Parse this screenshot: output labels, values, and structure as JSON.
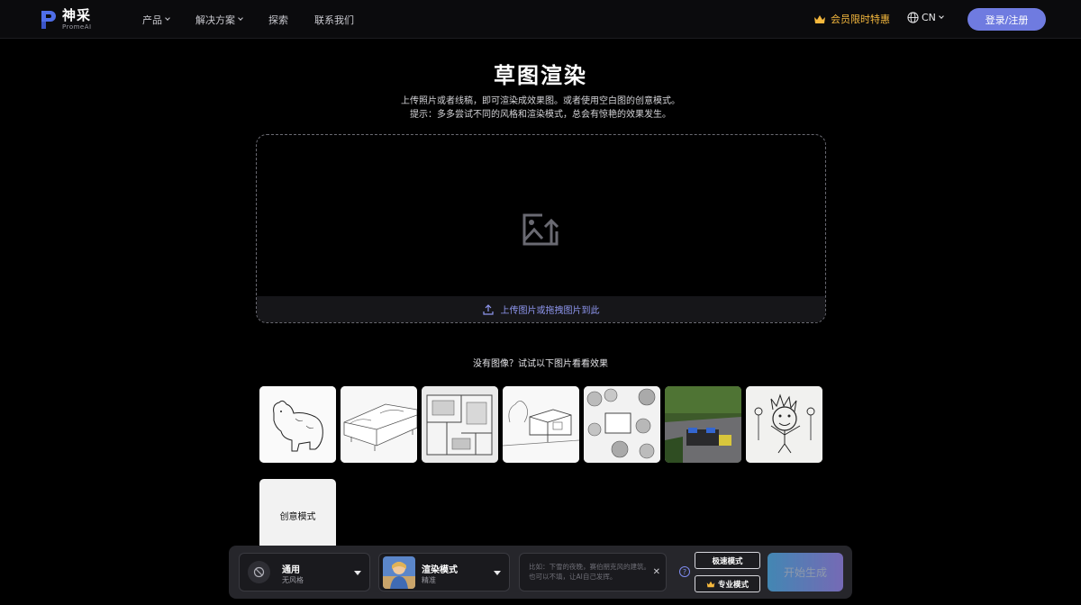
{
  "header": {
    "logo": {
      "cn": "神采",
      "en": "PromeAI"
    },
    "nav": [
      {
        "label": "产品",
        "dropdown": true
      },
      {
        "label": "解决方案",
        "dropdown": true
      },
      {
        "label": "探索",
        "dropdown": false
      },
      {
        "label": "联系我们",
        "dropdown": false
      }
    ],
    "promo_label": "会员限时特惠",
    "lang_label": "CN",
    "login_label": "登录/注册"
  },
  "page": {
    "title": "草图渲染",
    "subtitle_1": "上传照片或者线稿，即可渲染成效果图。或者使用空白图的创意模式。",
    "subtitle_2": "提示：多多尝试不同的风格和渲染模式，总会有惊艳的效果发生。"
  },
  "upload": {
    "label": "上传图片或拖拽图片到此"
  },
  "samples": {
    "hint": "没有图像？试试以下图片看看效果",
    "items": [
      "bear-sketch",
      "sofa-sketch",
      "floorplan-3d-sketch",
      "house-sketch",
      "garden-plan-sketch",
      "patio-photo",
      "kid-drawing"
    ],
    "creative_label": "创意模式"
  },
  "toolbar": {
    "style": {
      "name": "通用",
      "sub": "无风格"
    },
    "mode": {
      "name": "渲染模式",
      "sub": "精准"
    },
    "prompt_placeholder": "比如：下雪的夜晚，赛伯朋克风的建筑。也可以不填，让AI自己发挥。",
    "help": "?",
    "fast_mode": "极速模式",
    "pro_mode": "专业模式",
    "generate": "开始生成"
  },
  "colors": {
    "accent": "#6f7be0",
    "promo": "#f5b83d",
    "upload_text": "#8f97f0"
  }
}
